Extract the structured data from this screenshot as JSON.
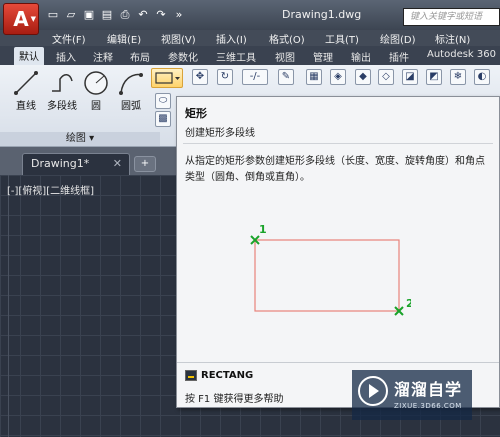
{
  "titlebar": {
    "document_title": "Drawing1.dwg",
    "search_placeholder": "键入关键字或短语",
    "app_button_glyph": "A",
    "quick_access": [
      "new-icon",
      "open-icon",
      "save-icon",
      "saveas-icon",
      "print-icon",
      "undo-icon",
      "redo-icon",
      "more-icon"
    ]
  },
  "menubar": {
    "items": [
      "文件(F)",
      "编辑(E)",
      "视图(V)",
      "插入(I)",
      "格式(O)",
      "工具(T)",
      "绘图(D)",
      "标注(N)"
    ]
  },
  "ribbon_tabs": [
    "默认",
    "插入",
    "注释",
    "布局",
    "参数化",
    "三维工具",
    "视图",
    "管理",
    "输出",
    "插件",
    "Autodesk 360"
  ],
  "ribbon": {
    "draw_tools": [
      {
        "label": "直线",
        "icon": "line-icon"
      },
      {
        "label": "多段线",
        "icon": "polyline-icon"
      },
      {
        "label": "圆",
        "icon": "circle-icon"
      },
      {
        "label": "圆弧",
        "icon": "arc-icon"
      }
    ],
    "draw_panel_label": "绘图 ▾"
  },
  "doc_tabs": {
    "active": "Drawing1*",
    "close_glyph": "✕"
  },
  "viewport_label": "[-][俯视][二维线框]",
  "tooltip": {
    "title": "矩形",
    "subtitle": "创建矩形多段线",
    "description": "从指定的矩形参数创建矩形多段线（长度、宽度、旋转角度）和角点类型（圆角、倒角或直角）。",
    "point1_label": "1",
    "point2_label": "2",
    "command": "RECTANG",
    "help": "按 F1 键获得更多帮助",
    "accent_color": "#e8837a",
    "point_color": "#1aa32a"
  },
  "watermark": {
    "name": "溜溜自学",
    "url": "ZIXUE.3D66.COM"
  }
}
